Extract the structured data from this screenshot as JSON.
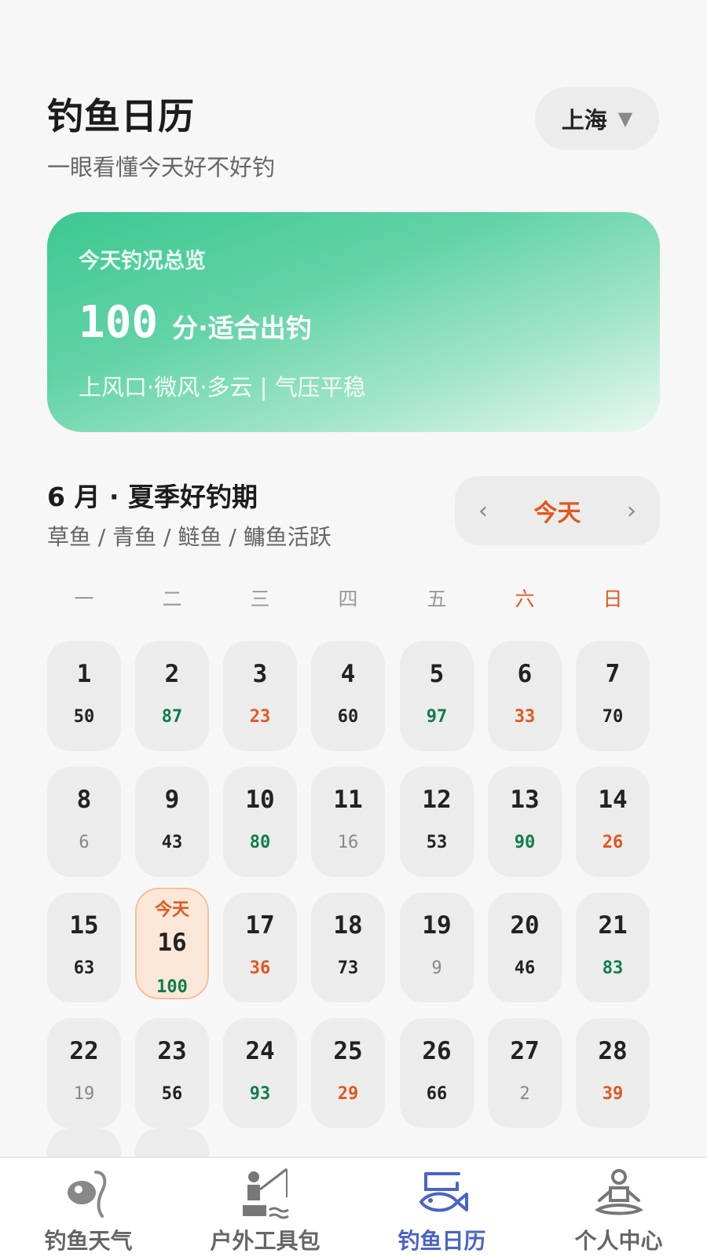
{
  "header": {
    "title": "钓鱼日历",
    "subtitle": "一眼看懂今天好不好钓",
    "city": "上海",
    "city_caret": "▼"
  },
  "overview": {
    "title": "今天钓况总览",
    "score": "100",
    "verdict": "分·适合出钓",
    "detail": "上风口·微风·多云 | 气压平稳"
  },
  "month": {
    "title": "6 月 · 夏季好钓期",
    "subtitle": "草鱼 / 青鱼 / 鲢鱼 / 鳙鱼活跃",
    "nav_prev": "‹",
    "nav_today": "今天",
    "nav_next": "›"
  },
  "weekdays": [
    "一",
    "二",
    "三",
    "四",
    "五",
    "六",
    "日"
  ],
  "calendar": {
    "today_tag": "今天",
    "days": [
      {
        "day": "1",
        "score": "50",
        "level": "mid"
      },
      {
        "day": "2",
        "score": "87",
        "level": "good"
      },
      {
        "day": "3",
        "score": "23",
        "level": "bad"
      },
      {
        "day": "4",
        "score": "60",
        "level": "mid"
      },
      {
        "day": "5",
        "score": "97",
        "level": "good"
      },
      {
        "day": "6",
        "score": "33",
        "level": "bad"
      },
      {
        "day": "7",
        "score": "70",
        "level": "mid"
      },
      {
        "day": "8",
        "score": "6",
        "level": "low"
      },
      {
        "day": "9",
        "score": "43",
        "level": "mid"
      },
      {
        "day": "10",
        "score": "80",
        "level": "good"
      },
      {
        "day": "11",
        "score": "16",
        "level": "low"
      },
      {
        "day": "12",
        "score": "53",
        "level": "mid"
      },
      {
        "day": "13",
        "score": "90",
        "level": "good"
      },
      {
        "day": "14",
        "score": "26",
        "level": "bad"
      },
      {
        "day": "15",
        "score": "63",
        "level": "mid"
      },
      {
        "day": "16",
        "score": "100",
        "level": "good",
        "today": true
      },
      {
        "day": "17",
        "score": "36",
        "level": "bad"
      },
      {
        "day": "18",
        "score": "73",
        "level": "mid"
      },
      {
        "day": "19",
        "score": "9",
        "level": "low"
      },
      {
        "day": "20",
        "score": "46",
        "level": "mid"
      },
      {
        "day": "21",
        "score": "83",
        "level": "good"
      },
      {
        "day": "22",
        "score": "19",
        "level": "low"
      },
      {
        "day": "23",
        "score": "56",
        "level": "mid"
      },
      {
        "day": "24",
        "score": "93",
        "level": "good"
      },
      {
        "day": "25",
        "score": "29",
        "level": "bad"
      },
      {
        "day": "26",
        "score": "66",
        "level": "mid"
      },
      {
        "day": "27",
        "score": "2",
        "level": "low"
      },
      {
        "day": "28",
        "score": "39",
        "level": "bad"
      }
    ]
  },
  "tabs": [
    {
      "label": "钓鱼天气",
      "icon": "fishing-hook-icon"
    },
    {
      "label": "户外工具包",
      "icon": "angler-icon"
    },
    {
      "label": "钓鱼日历",
      "icon": "fish-calendar-icon",
      "active": true
    },
    {
      "label": "个人中心",
      "icon": "meditation-person-icon"
    }
  ],
  "colors": {
    "accent_orange": "#e0581e",
    "good_green": "#0d7e4d",
    "tab_active": "#4b63c7",
    "card_gradient_start": "#3cc892"
  }
}
